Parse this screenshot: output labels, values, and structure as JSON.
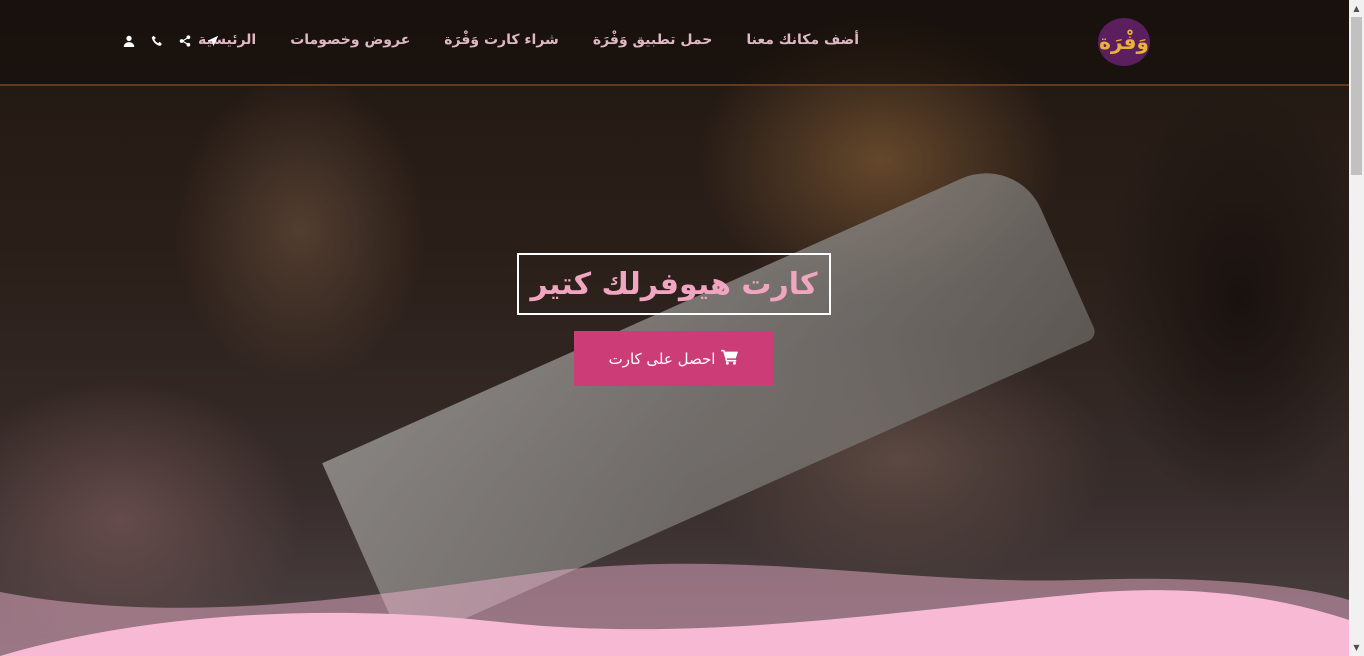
{
  "brand": {
    "logo_text": "وَفْرَة",
    "logo_bg": "#5a1f5c",
    "logo_fg": "#e9b23a"
  },
  "nav": {
    "items": [
      {
        "label": "الرئيسية"
      },
      {
        "label": "عروض وخصومات"
      },
      {
        "label": "شراء كارت وَفْرَة"
      },
      {
        "label": "حمل تطبيق وَفْرَة"
      },
      {
        "label": "أضف مكانك معنا"
      }
    ],
    "icons": [
      "location-arrow-icon",
      "share-icon",
      "phone-icon",
      "user-icon"
    ]
  },
  "hero": {
    "headline": "كارت هيوفرلك كتير",
    "cta_label": "احصل على كارت",
    "cta_icon": "cart-icon"
  },
  "colors": {
    "accent": "#cc3d78",
    "headline": "#f0a6c0",
    "wave_light": "#f8b9d4",
    "nav_text": "#e0b7c4"
  }
}
